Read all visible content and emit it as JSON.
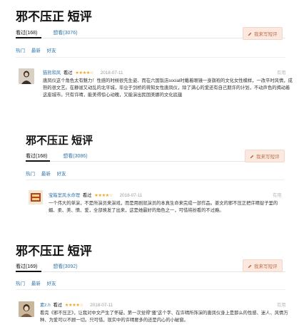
{
  "panels": [
    {
      "title": "邪不压正 短评",
      "tabs": [
        "看过(168)",
        "想看(3076)"
      ],
      "write_label": "我来写短评",
      "filters": [
        "热门",
        "最新",
        "好友"
      ],
      "comment": {
        "username": "猫熊和风",
        "status": "看过",
        "stars": "★★★★☆",
        "rating": 4,
        "date": "2018-07-11",
        "useful": "有用",
        "text": "唐凤仪这个角色太有魅力！性感的时候很先生姿、而在六国饭店social时戴着眼镜一身旗袍的文化女性模样，一改平时风情，成熟的很文艺。在静谧又动乱的北平城，毕业于剑桥的蒋知女性唐凤仪，除了满心的爱还有自己期许的计划，不动声色的揭动着这座城市。只有许晴，能美得惊心动魄，又能演出民国美娜的文化底蕴"
      }
    },
    {
      "title": "邪不压正 短评",
      "tabs": [
        "看过(168)",
        "想看(3086)"
      ],
      "write_label": "我来写短评",
      "filters": [
        "热门",
        "最新",
        "好友"
      ],
      "comment": {
        "username": "宝箱室风水命理",
        "status": "看过",
        "stars": "★★★★☆",
        "rating": 4,
        "date": "2018-07-11",
        "useful": "有用",
        "text": "一个伟大的单演，不是所演员来演戏，而是用剧就演员的本真生命来完成一部作品。姜文的邪不压正把许晴捉子里的媚、柔、美、情、爱，全部焕发了出来，这是她最好的角色之一，可惜将扮看的不过瘾。"
      }
    },
    {
      "title": "邪不压正 短评",
      "tabs": [
        "看过(169)",
        "想看(3092)"
      ],
      "write_label": "我来写短评",
      "filters": [
        "热门",
        "最新",
        "好友"
      ],
      "comment": {
        "username": "素z.h",
        "status": "看过",
        "stars": "★★★★☆",
        "rating": 4,
        "date": "2018-07-11",
        "useful": "有用",
        "text": "看完《邪不压正》，让我对中文产生了怀疑。第一次觉得\"骚\"这个字、在许晴所饰演的唐凤仪身上是那么的性感、迷人、风情万种、为爱可以不顾一切。只可惜，现实中的许晴要多的还是内心的小破窗。"
      }
    }
  ],
  "colors": {
    "link": "#3377aa",
    "star": "#f5a623",
    "button_bg": "#fbe9e0",
    "button_text": "#c0704a"
  }
}
